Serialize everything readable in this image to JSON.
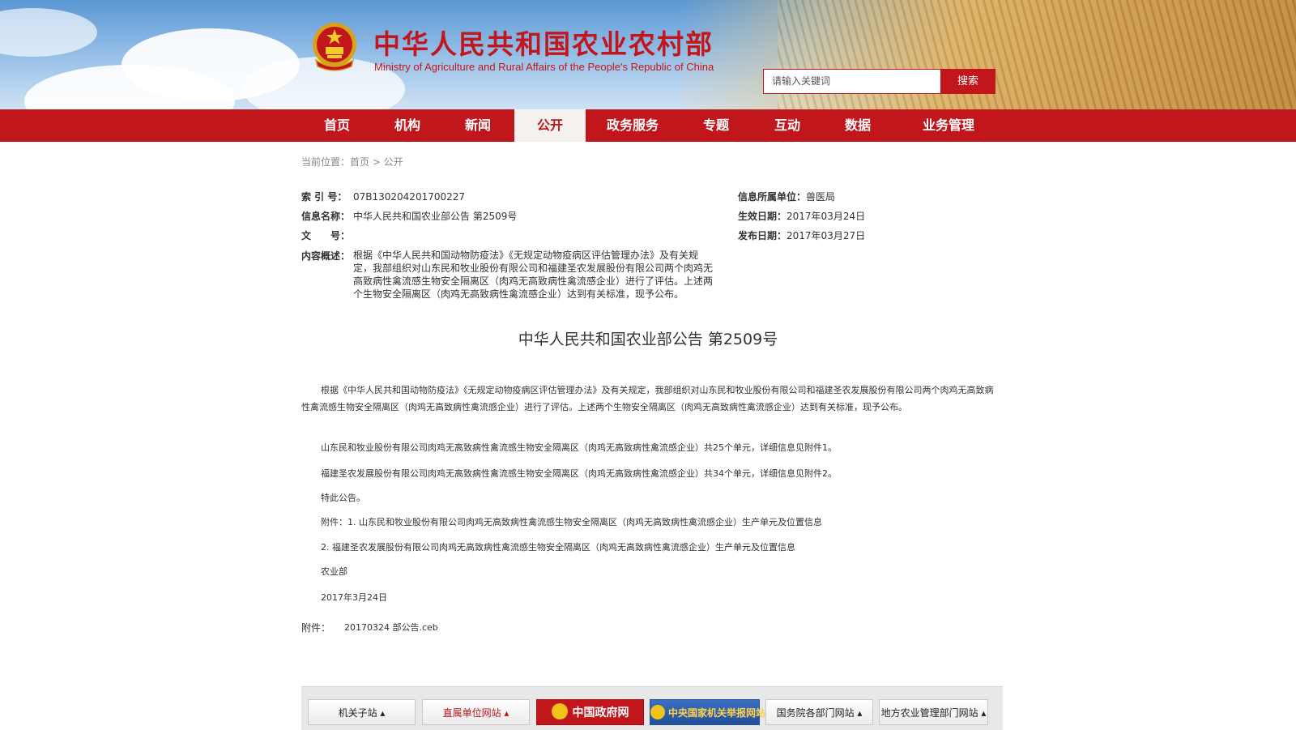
{
  "header": {
    "title": "中华人民共和国农业农村部",
    "subtitle": "Ministry of Agriculture and Rural Affairs of the People's Republic of China",
    "search_placeholder": "请输入关键词",
    "search_button": "搜索"
  },
  "nav": {
    "items": [
      {
        "label": "首页",
        "active": false
      },
      {
        "label": "机构",
        "active": false
      },
      {
        "label": "新闻",
        "active": false
      },
      {
        "label": "公开",
        "active": true
      },
      {
        "label": "政务服务",
        "active": false
      },
      {
        "label": "专题",
        "active": false
      },
      {
        "label": "互动",
        "active": false
      },
      {
        "label": "数据",
        "active": false
      },
      {
        "label": "业务管理",
        "active": false
      }
    ]
  },
  "breadcrumb": "当前位置：首页 > 公开",
  "meta": {
    "index_label": "索 引 号：",
    "index_value": "07B130204201700227",
    "name_label": "信息名称：",
    "name_value": "中华人民共和国农业部公告 第2509号",
    "docno_label": "文　　号：",
    "docno_value": "",
    "summary_label": "内容概述：",
    "summary_value": "根据《中华人民共和国动物防疫法》《无规定动物疫病区评估管理办法》及有关规定，我部组织对山东民和牧业股份有限公司和福建圣农发展股份有限公司两个肉鸡无高致病性禽流感生物安全隔离区（肉鸡无高致病性禽流感企业）进行了评估。上述两个生物安全隔离区（肉鸡无高致病性禽流感企业）达到有关标准，现予公布。",
    "unit_label": "信息所属单位：",
    "unit_value": "兽医局",
    "effective_label": "生效日期：",
    "effective_value": "2017年03月24日",
    "publish_label": "发布日期：",
    "publish_value": "2017年03月27日"
  },
  "document": {
    "title": "中华人民共和国农业部公告 第2509号",
    "paragraphs": [
      "根据《中华人民共和国动物防疫法》《无规定动物疫病区评估管理办法》及有关规定，我部组织对山东民和牧业股份有限公司和福建圣农发展股份有限公司两个肉鸡无高致病性禽流感生物安全隔离区（肉鸡无高致病性禽流感企业）进行了评估。上述两个生物安全隔离区（肉鸡无高致病性禽流感企业）达到有关标准，现予公布。",
      "山东民和牧业股份有限公司肉鸡无高致病性禽流感生物安全隔离区（肉鸡无高致病性禽流感企业）共25个单元，详细信息见附件1。",
      "福建圣农发展股份有限公司肉鸡无高致病性禽流感生物安全隔离区（肉鸡无高致病性禽流感企业）共34个单元，详细信息见附件2。",
      "特此公告。",
      "附件：1. 山东民和牧业股份有限公司肉鸡无高致病性禽流感生物安全隔离区（肉鸡无高致病性禽流感企业）生产单元及位置信息",
      "2. 福建圣农发展股份有限公司肉鸡无高致病性禽流感生物安全隔离区（肉鸡无高致病性禽流感企业）生产单元及位置信息",
      "农业部",
      "2017年3月24日"
    ]
  },
  "attachment": {
    "label": "附件：",
    "file": "20170324 部公告.ceb"
  },
  "footer": {
    "links": [
      "机关子站 ▴",
      "直属单位网站 ▴",
      "中国政府网",
      "中央国家机关举报网站",
      "国务院各部门网站 ▴",
      "地方农业管理部门网站 ▴"
    ]
  },
  "colors": {
    "brand_red": "#c1161c",
    "nav_active_bg": "#f5f1ee"
  }
}
